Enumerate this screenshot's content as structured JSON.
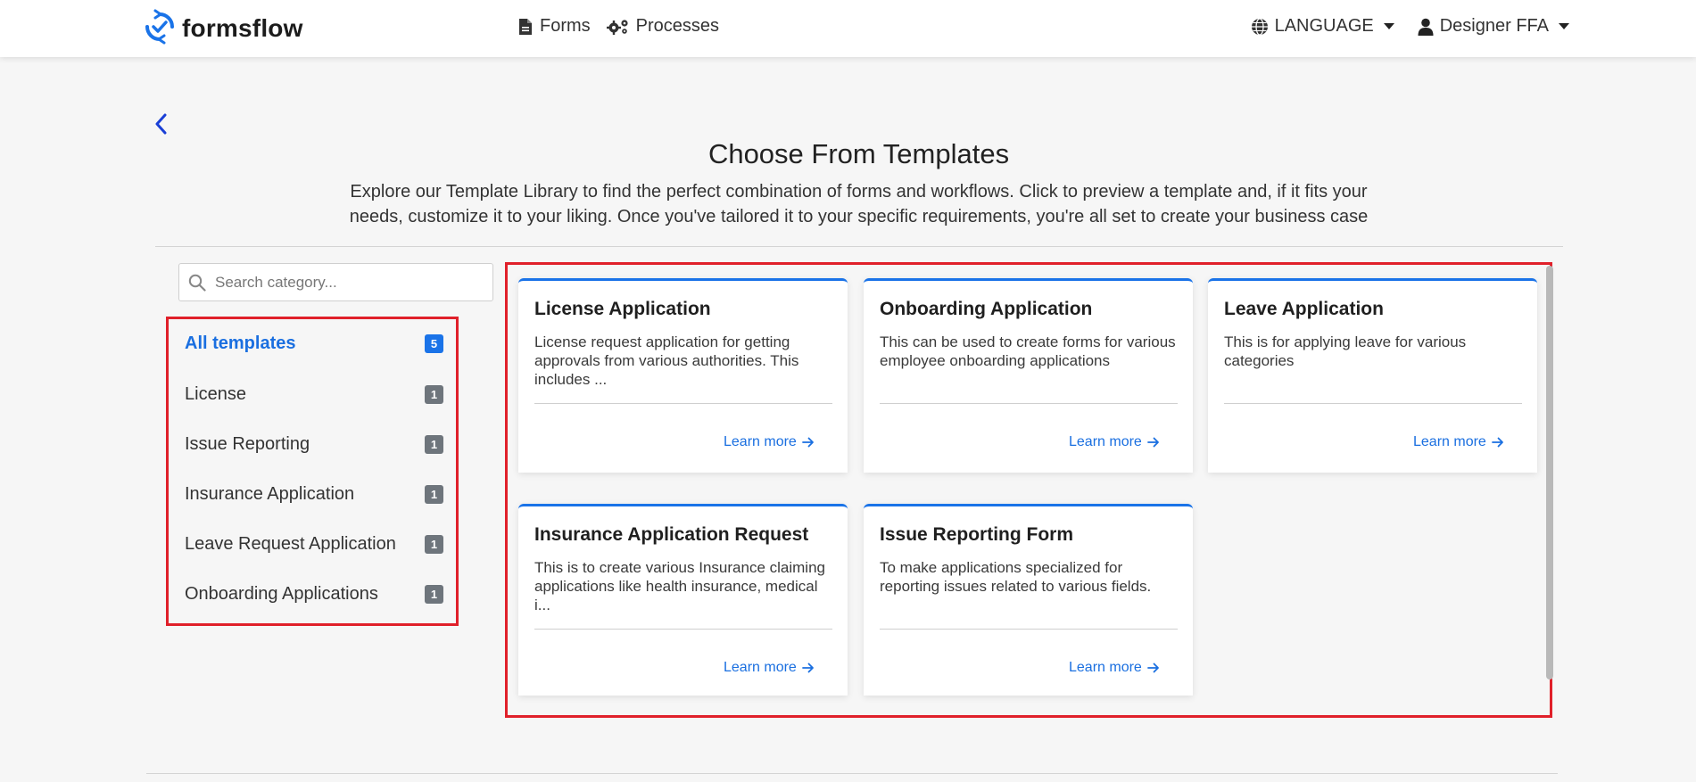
{
  "app": {
    "brand": "formsflow"
  },
  "nav": {
    "forms": "Forms",
    "processes": "Processes",
    "language": "LANGUAGE",
    "user": "Designer FFA"
  },
  "page": {
    "title": "Choose From Templates",
    "description": "Explore our Template Library to find the perfect combination of forms and workflows. Click to preview a template and, if it fits your needs, customize it to your liking. Once you've tailored it to your specific requirements, you're all set to create your business case"
  },
  "search": {
    "placeholder": "Search category..."
  },
  "categories": [
    {
      "label": "All templates",
      "count": "5"
    },
    {
      "label": "License",
      "count": "1"
    },
    {
      "label": "Issue Reporting",
      "count": "1"
    },
    {
      "label": "Insurance Application",
      "count": "1"
    },
    {
      "label": "Leave Request Application",
      "count": "1"
    },
    {
      "label": "Onboarding Applications",
      "count": "1"
    }
  ],
  "templates": [
    {
      "title": "License Application",
      "description": "License request application for getting approvals from various authorities. This includes ...",
      "link": "Learn more"
    },
    {
      "title": "Onboarding Application",
      "description": "This can be used to create forms for various employee onboarding applications",
      "link": "Learn more"
    },
    {
      "title": "Leave Application",
      "description": "This is for applying leave for various categories",
      "link": "Learn more"
    },
    {
      "title": "Insurance Application Request",
      "description": "This is to create various Insurance claiming applications like health insurance, medical i...",
      "link": "Learn more"
    },
    {
      "title": "Issue Reporting Form",
      "description": "To make applications specialized for reporting issues related to various fields.",
      "link": "Learn more"
    }
  ],
  "colors": {
    "accent": "#1a73e8",
    "highlight": "#e0202a",
    "badge": "#6e757c"
  }
}
